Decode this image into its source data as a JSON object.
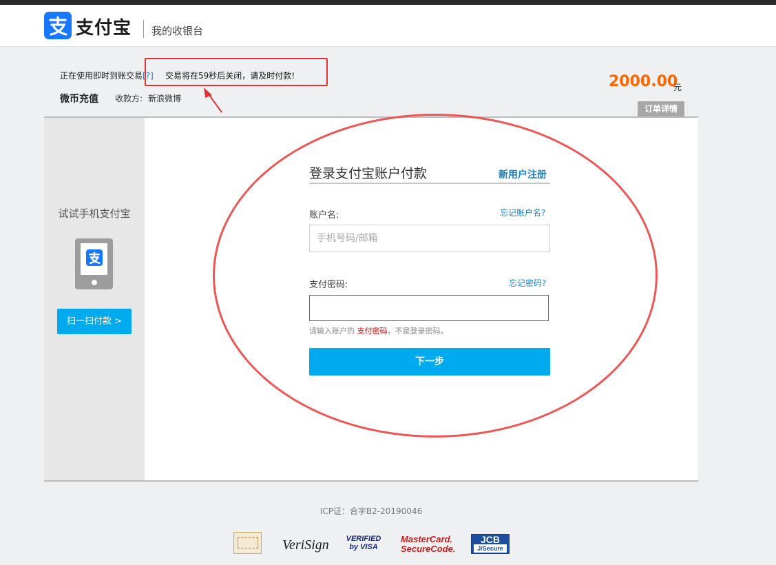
{
  "header": {
    "logo_text": "支付宝",
    "cashier_label": "我的收银台",
    "logo_icon": "alipay-logo-icon"
  },
  "order": {
    "usage_text": "正在使用即时到账交易",
    "help_mark": "[?]",
    "notice": "交易将在59秒后关闭，请及时付款!",
    "title": "微币充值",
    "payee_label": "收款方:",
    "payee_value": "新浪微博",
    "amount": "2000.00",
    "amount_unit": "元",
    "detail_tab": "订单详情"
  },
  "side": {
    "title": "试试手机支付宝",
    "scan_button": "扫一扫付款 >",
    "phone_icon": "phone-icon"
  },
  "login": {
    "title": "登录支付宝账户付款",
    "register": "新用户注册",
    "account_label": "账户名:",
    "forgot_account": "忘记账户名?",
    "account_placeholder": "手机号码/邮箱",
    "password_label": "支付密码:",
    "forgot_password": "忘记密码?",
    "hint_prefix": "请输入账户的",
    "hint_highlight": "支付密码",
    "hint_suffix": "，不是登录密码。",
    "next_button": "下一步"
  },
  "footer": {
    "icp": "ICP证：合字B2-20190046",
    "badges": {
      "verisign": "VeriSign",
      "visa_line1": "VERIFIED",
      "visa_line2": "by VISA",
      "mastercard_line1": "MasterCard.",
      "mastercard_line2": "SecureCode.",
      "jcb_line1": "JCB",
      "jcb_line2": "J/Secure"
    }
  },
  "colors": {
    "brand_blue": "#1677ff",
    "button_blue": "#00aaee",
    "amount_orange": "#ff6600",
    "annotation_red": "#e03434"
  }
}
